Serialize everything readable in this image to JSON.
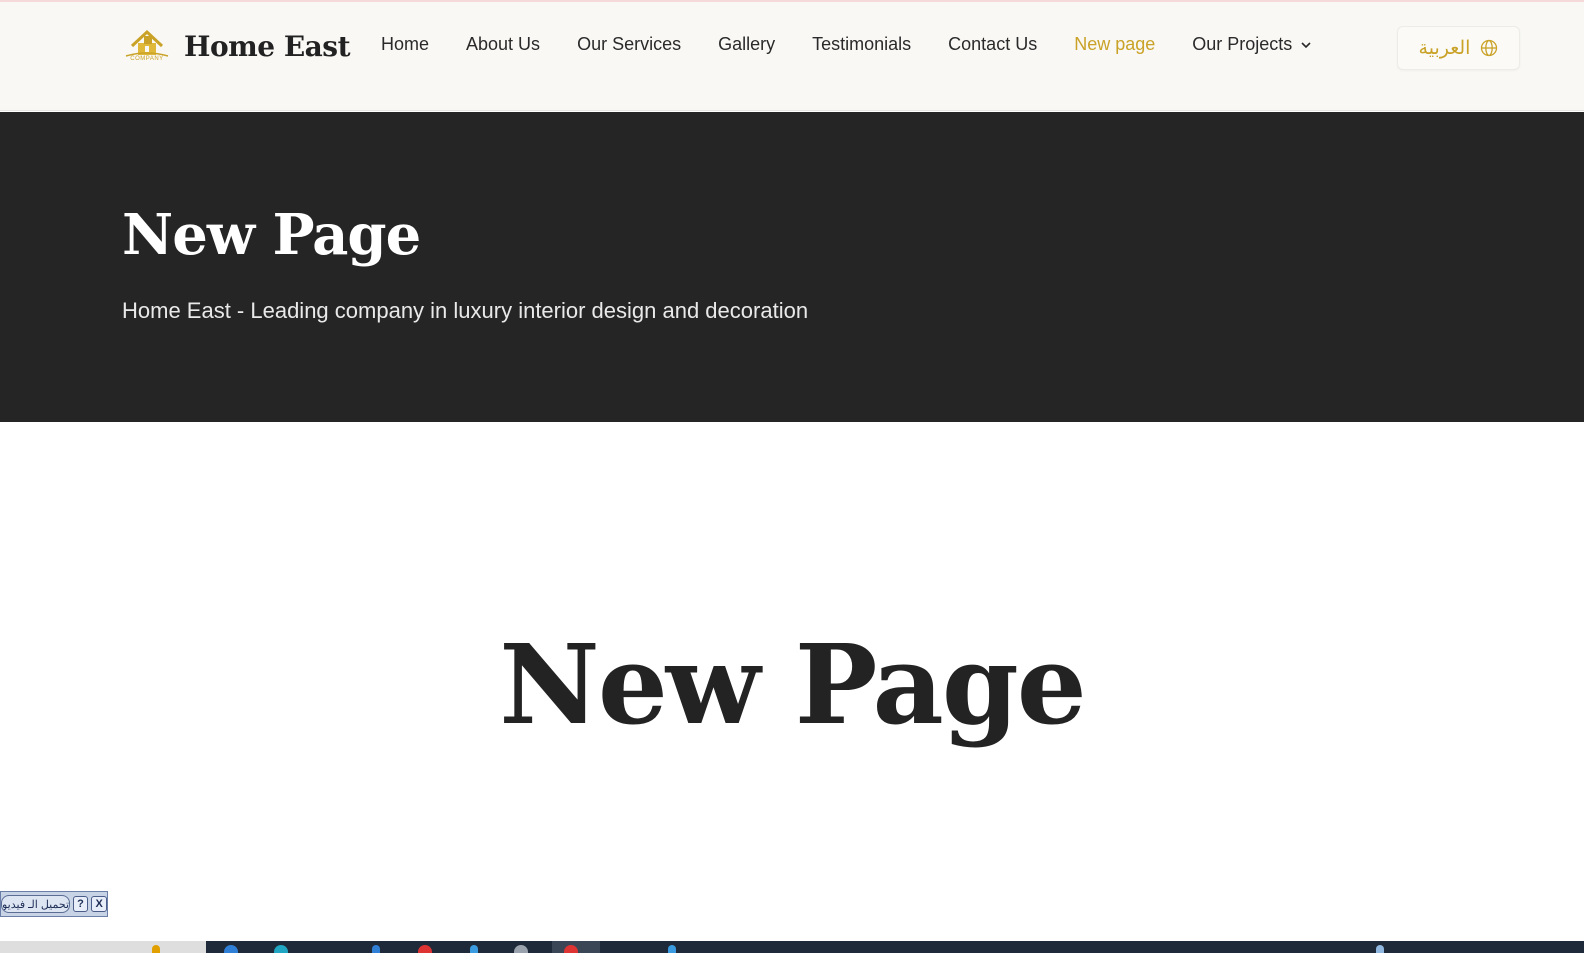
{
  "brand": {
    "name": "Home East",
    "logo_caption": "COMPANY",
    "accent_color": "#c9a227"
  },
  "nav": {
    "items": [
      {
        "label": "Home"
      },
      {
        "label": "About Us"
      },
      {
        "label": "Our Services"
      },
      {
        "label": "Gallery"
      },
      {
        "label": "Testimonials"
      },
      {
        "label": "Contact Us"
      },
      {
        "label": "New page",
        "active": true
      },
      {
        "label": "Our Projects",
        "has_dropdown": true,
        "icon": "chevron-down-icon"
      }
    ],
    "language_button": {
      "label": "العربية",
      "icon": "globe-icon"
    }
  },
  "hero": {
    "title": "New Page",
    "subtitle": "Home East - Leading company in luxury interior design and decoration",
    "background": "#252525"
  },
  "main": {
    "title": "New Page"
  },
  "overlay_widget": {
    "label": "تحميل الـ فيديو",
    "help_icon": "help-icon",
    "close_icon": "close-icon",
    "help_glyph": "?",
    "close_glyph": "X"
  }
}
